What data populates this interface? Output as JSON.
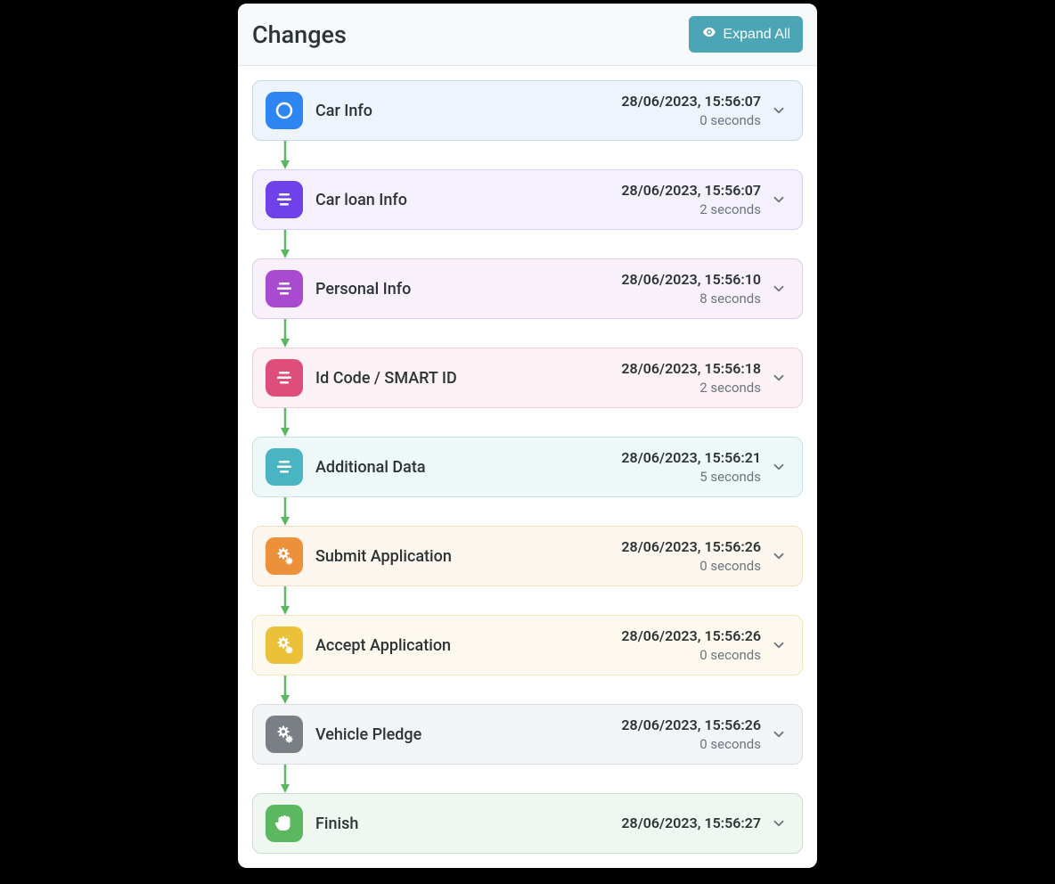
{
  "header": {
    "title": "Changes",
    "expand_label": "Expand All"
  },
  "steps": [
    {
      "label": "Car Info",
      "timestamp": "28/06/2023, 15:56:07",
      "duration": "0 seconds",
      "theme": "blue",
      "icon": "circle"
    },
    {
      "label": "Car loan Info",
      "timestamp": "28/06/2023, 15:56:07",
      "duration": "2 seconds",
      "theme": "indigo",
      "icon": "form"
    },
    {
      "label": "Personal Info",
      "timestamp": "28/06/2023, 15:56:10",
      "duration": "8 seconds",
      "theme": "purple",
      "icon": "form"
    },
    {
      "label": "Id Code / SMART ID",
      "timestamp": "28/06/2023, 15:56:18",
      "duration": "2 seconds",
      "theme": "pink",
      "icon": "form"
    },
    {
      "label": "Additional Data",
      "timestamp": "28/06/2023, 15:56:21",
      "duration": "5 seconds",
      "theme": "teal",
      "icon": "form"
    },
    {
      "label": "Submit Application",
      "timestamp": "28/06/2023, 15:56:26",
      "duration": "0 seconds",
      "theme": "orange",
      "icon": "gears"
    },
    {
      "label": "Accept Application",
      "timestamp": "28/06/2023, 15:56:26",
      "duration": "0 seconds",
      "theme": "yellow",
      "icon": "gears"
    },
    {
      "label": "Vehicle Pledge",
      "timestamp": "28/06/2023, 15:56:26",
      "duration": "0 seconds",
      "theme": "gray",
      "icon": "gears"
    },
    {
      "label": "Finish",
      "timestamp": "28/06/2023, 15:56:27",
      "duration": "",
      "theme": "green",
      "icon": "hand"
    }
  ]
}
